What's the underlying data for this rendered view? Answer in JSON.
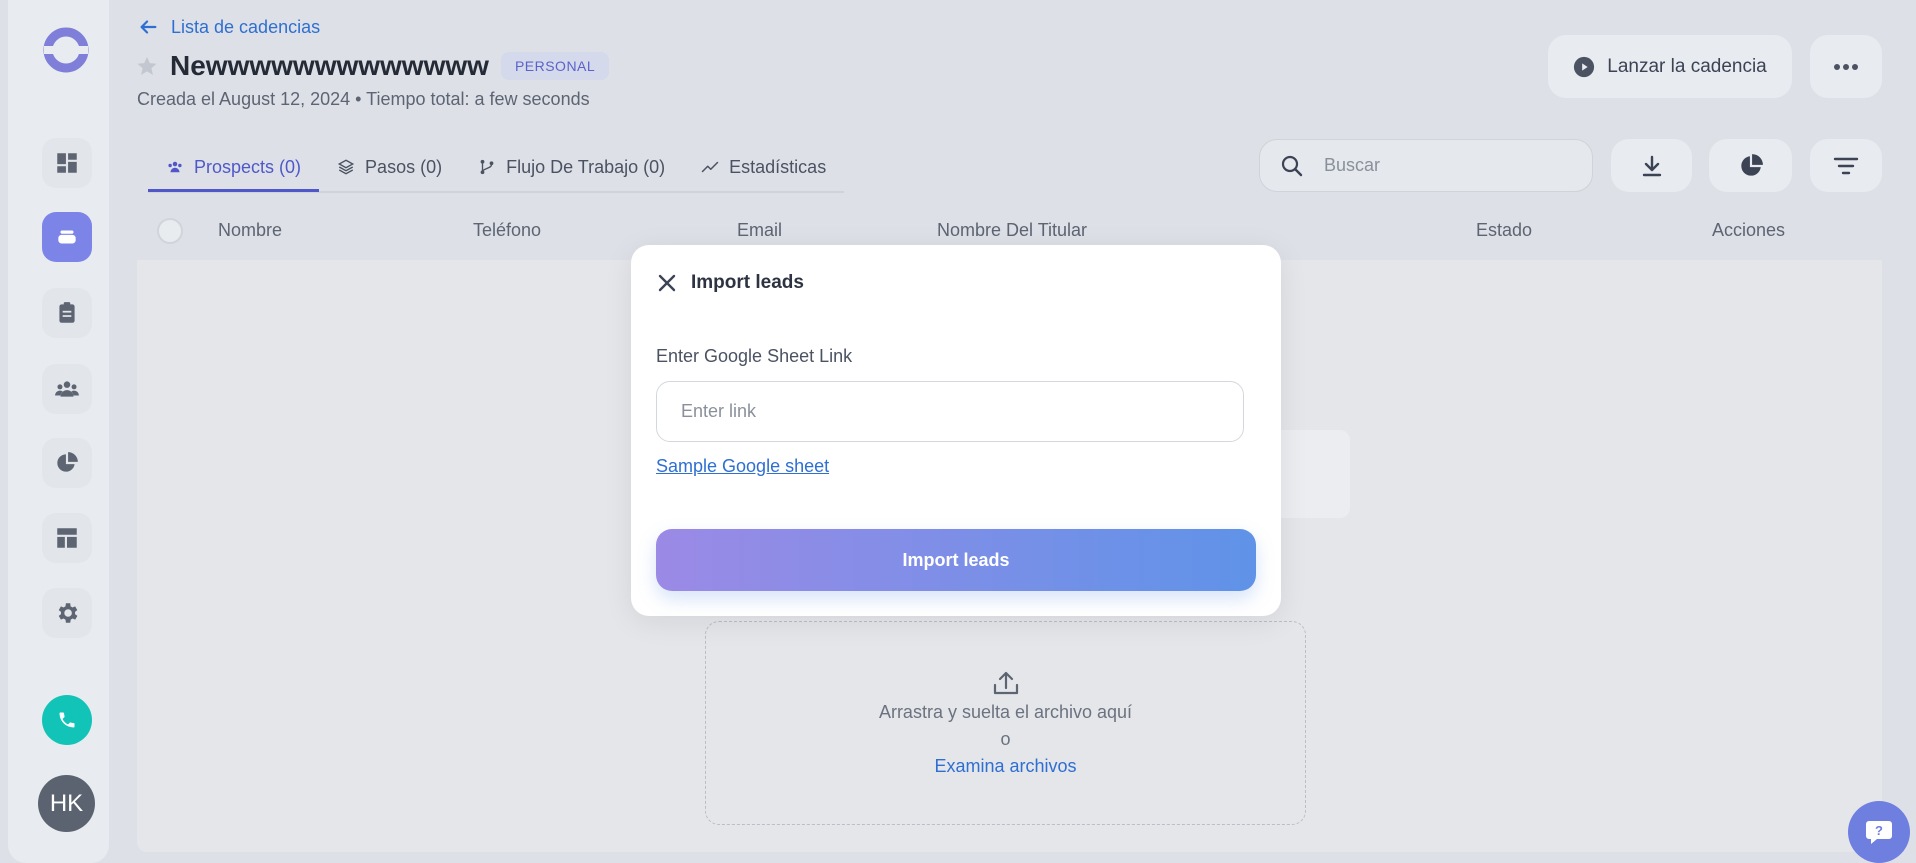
{
  "header": {
    "back_label": "Lista de cadencias",
    "title": "Newwwwwwwwwwwww",
    "badge": "PERSONAL",
    "subtitle": "Creada el August 12, 2024 • Tiempo total: a few seconds",
    "launch_label": "Lanzar la cadencia"
  },
  "tabs": [
    {
      "label": "Prospects (0)",
      "active": true
    },
    {
      "label": "Pasos (0)",
      "active": false
    },
    {
      "label": "Flujo De Trabajo (0)",
      "active": false
    },
    {
      "label": "Estadísticas",
      "active": false
    }
  ],
  "search": {
    "placeholder": "Buscar"
  },
  "table": {
    "columns": [
      "Nombre",
      "Teléfono",
      "Email",
      "Nombre Del Titular",
      "Estado",
      "Acciones"
    ]
  },
  "dropzone": {
    "line1": "Arrastra y suelta el archivo aquí",
    "or": "o",
    "browse": "Examina archivos"
  },
  "modal": {
    "title": "Import leads",
    "field_label": "Enter Google Sheet Link",
    "input_placeholder": "Enter link",
    "input_value": "",
    "sample_link": "Sample Google sheet",
    "submit_label": "Import leads"
  },
  "user": {
    "initials": "HK"
  },
  "colors": {
    "accent": "#5058c9",
    "link": "#2f6fd1",
    "call": "#12c3b8",
    "button_gradient_start": "#9b8ae6",
    "button_gradient_end": "#5f93e8"
  }
}
